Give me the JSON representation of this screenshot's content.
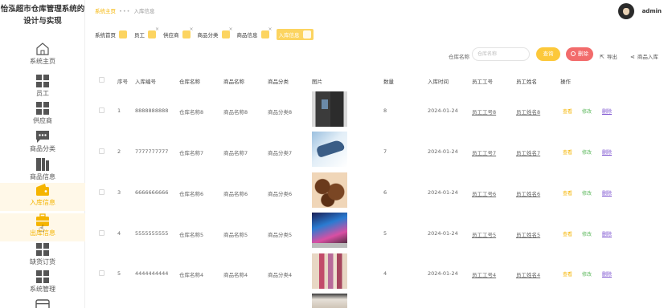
{
  "app": {
    "title": "怡泓超市仓库管理系统的设计与实现",
    "title_line1": "怡泓超市仓库管理系统的",
    "title_line2": "设计与实现"
  },
  "sidebar": {
    "items": [
      {
        "label": "系统主页",
        "icon": "home-icon"
      },
      {
        "label": "员工",
        "icon": "grid-icon"
      },
      {
        "label": "供应商",
        "icon": "grid-icon"
      },
      {
        "label": "商品分类",
        "icon": "chat-icon"
      },
      {
        "label": "商品信息",
        "icon": "book-icon"
      },
      {
        "label": "入库信息",
        "icon": "wallet-icon",
        "active": true
      },
      {
        "label": "出库信息",
        "icon": "briefcase-icon"
      },
      {
        "label": "缺货订货",
        "icon": "grid-icon"
      },
      {
        "label": "系统管理",
        "icon": "grid-icon"
      }
    ]
  },
  "header": {
    "breadcrumb_home": "系统主页",
    "breadcrumb_sep": "•••",
    "breadcrumb_current": "入库信息",
    "username": "admin"
  },
  "tabs": [
    {
      "label": "系统首页",
      "closable": false
    },
    {
      "label": "员工",
      "closable": true
    },
    {
      "label": "供应商",
      "closable": true
    },
    {
      "label": "商品分类",
      "closable": true
    },
    {
      "label": "商品信息",
      "closable": true
    },
    {
      "label": "入库信息",
      "closable": false,
      "active": true
    }
  ],
  "toolbar": {
    "search_label": "仓库名称",
    "search_placeholder": "仓库名称",
    "search_button": "查询",
    "delete_button": "删除",
    "export_link": "导出",
    "import_link": "商品入库"
  },
  "table": {
    "headers": [
      "序号",
      "入库编号",
      "仓库名称",
      "商品名称",
      "商品分类",
      "图片",
      "数量",
      "入库时间",
      "员工工号",
      "员工姓名",
      "操作"
    ],
    "rows": [
      {
        "index": "1",
        "code": "8888888888",
        "warehouse": "仓库名称8",
        "product": "商品名称8",
        "category": "商品分类8",
        "image": "fridge",
        "qty": "8",
        "date": "2024-01-24",
        "emp_no": "员工工号8",
        "emp_name": "员工姓名8"
      },
      {
        "index": "2",
        "code": "7777777777",
        "warehouse": "仓库名称7",
        "product": "商品名称7",
        "category": "商品分类7",
        "image": "shoes",
        "qty": "7",
        "date": "2024-01-24",
        "emp_no": "员工工号7",
        "emp_name": "员工姓名7"
      },
      {
        "index": "3",
        "code": "6666666666",
        "warehouse": "仓库名称6",
        "product": "商品名称6",
        "category": "商品分类6",
        "image": "chocolate",
        "qty": "6",
        "date": "2024-01-24",
        "emp_no": "员工工号6",
        "emp_name": "员工姓名6"
      },
      {
        "index": "4",
        "code": "5555555555",
        "warehouse": "仓库名称5",
        "product": "商品名称5",
        "category": "商品分类5",
        "image": "laptop",
        "qty": "5",
        "date": "2024-01-24",
        "emp_no": "员工工号5",
        "emp_name": "员工姓名5"
      },
      {
        "index": "5",
        "code": "4444444444",
        "warehouse": "仓库名称4",
        "product": "商品名称4",
        "category": "商品分类4",
        "image": "drinks",
        "qty": "4",
        "date": "2024-01-24",
        "emp_no": "员工工号4",
        "emp_name": "员工姓名4"
      }
    ],
    "action_view": "查看",
    "action_edit": "修改",
    "action_delete": "删除"
  },
  "colors": {
    "accent": "#fcc83a",
    "danger": "#f26b6b",
    "delete_link": "#7a4fcf",
    "edit_link": "#5cb85c"
  }
}
